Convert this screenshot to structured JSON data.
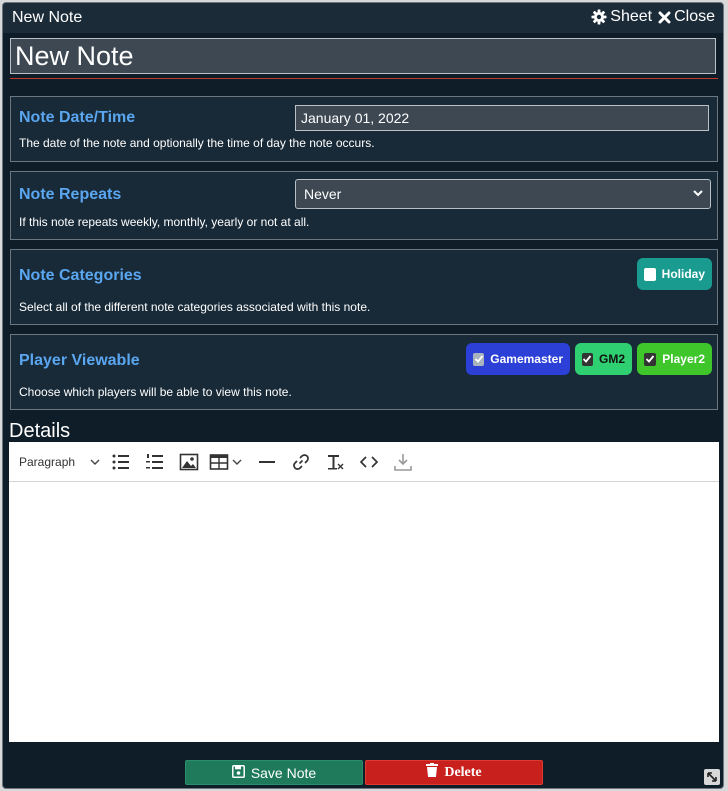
{
  "window": {
    "title": "New Note",
    "sheet_label": "Sheet",
    "close_label": "Close"
  },
  "note": {
    "title_value": "New Note"
  },
  "date_section": {
    "heading": "Note Date/Time",
    "description": "The date of the note and optionally the time of day the note occurs.",
    "value": "January 01, 2022"
  },
  "repeat_section": {
    "heading": "Note Repeats",
    "description": "If this note repeats weekly, monthly, yearly or not at all.",
    "selected": "Never"
  },
  "categories_section": {
    "heading": "Note Categories",
    "description": "Select all of the different note categories associated with this note.",
    "chips": [
      {
        "label": "Holiday",
        "checked": false,
        "color": "#1a9b8f"
      }
    ]
  },
  "viewable_section": {
    "heading": "Player Viewable",
    "description": "Choose which players will be able to view this note.",
    "chips": [
      {
        "label": "Gamemaster",
        "checked": true,
        "color": "#2c3fd6"
      },
      {
        "label": "GM2",
        "checked": true,
        "color": "#2fd071"
      },
      {
        "label": "Player2",
        "checked": true,
        "color": "#3ec62a"
      }
    ]
  },
  "details": {
    "label": "Details",
    "toolbar": {
      "paragraph_label": "Paragraph"
    }
  },
  "buttons": {
    "save": "Save Note",
    "delete": "Delete"
  },
  "colors": {
    "accent_heading": "#5aa6f0",
    "save": "#1e7a5a",
    "delete": "#c8201d"
  }
}
